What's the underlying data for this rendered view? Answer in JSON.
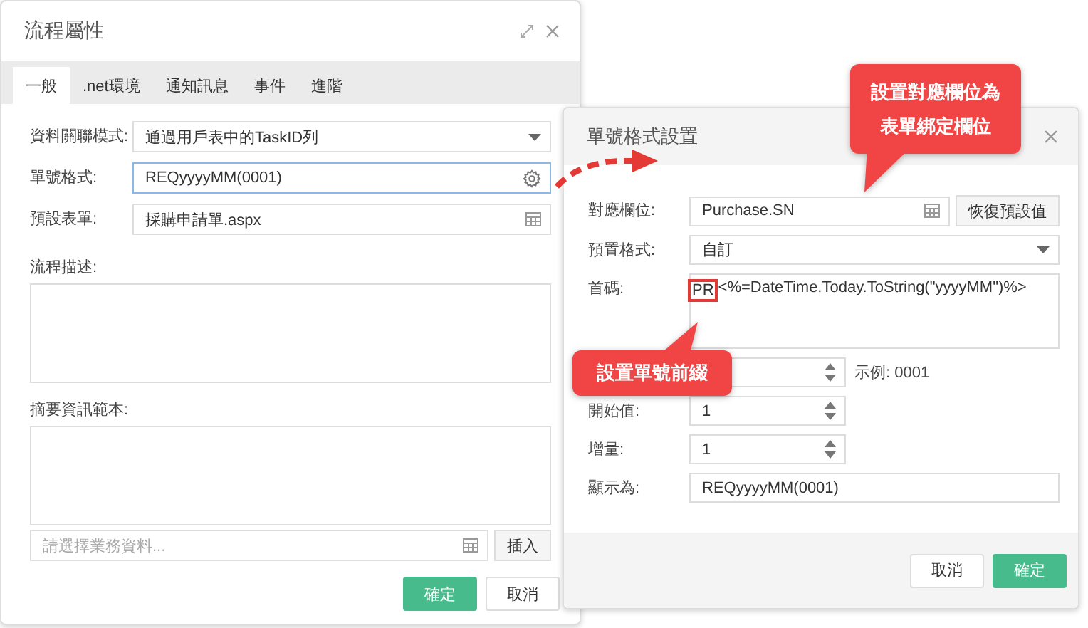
{
  "main_dialog": {
    "title": "流程屬性",
    "tabs": [
      {
        "label": "一般",
        "selected": true
      },
      {
        "label": ".net環境",
        "selected": false
      },
      {
        "label": "通知訊息",
        "selected": false
      },
      {
        "label": "事件",
        "selected": false
      },
      {
        "label": "進階",
        "selected": false
      }
    ],
    "fields": [
      {
        "label": "資料關聯模式:",
        "kind": "select",
        "value": "通過用戶表中的TaskID列",
        "focused": false
      },
      {
        "label": "單號格式:",
        "kind": "gear",
        "value": "REQyyyyMM(0001)",
        "focused": true
      },
      {
        "label": "預設表單:",
        "kind": "picker",
        "value": "採購申請單.aspx",
        "focused": false
      }
    ],
    "description": {
      "label": "流程描述:"
    },
    "summary": {
      "label": "摘要資訊範本:",
      "picker": {
        "placeholder": "請選擇業務資料..."
      },
      "insert_button": "插入"
    },
    "buttons": [
      {
        "label": "確定",
        "kind": "primary"
      },
      {
        "label": "取消",
        "kind": "default"
      }
    ]
  },
  "format_dialog": {
    "title": "單號格式設置",
    "fields": [
      {
        "label": "對應欄位:",
        "kind": "picker",
        "value": "Purchase.SN",
        "button": "恢復預設值"
      },
      {
        "label": "預置格式:",
        "kind": "select",
        "value": "自訂"
      },
      {
        "label": "首碼:",
        "kind": "textarea",
        "marked_text": "PR",
        "value": "<%=DateTime.Today.ToString(\"yyyyMM\")%>"
      },
      {
        "kind": "spinner",
        "hint": "示例: 0001"
      },
      {
        "label": "開始值:",
        "kind": "spinner",
        "value": "1"
      },
      {
        "label": "增量:",
        "kind": "spinner",
        "value": "1"
      },
      {
        "label": "顯示為:",
        "kind": "text",
        "value": "REQyyyyMM(0001)"
      }
    ],
    "buttons": [
      {
        "label": "取消",
        "kind": "default"
      },
      {
        "label": "確定",
        "kind": "primary"
      }
    ]
  },
  "callouts": [
    {
      "lines": [
        "設置對應欄位為",
        "表單綁定欄位"
      ]
    },
    {
      "lines": [
        "設置單號前綴"
      ]
    }
  ]
}
